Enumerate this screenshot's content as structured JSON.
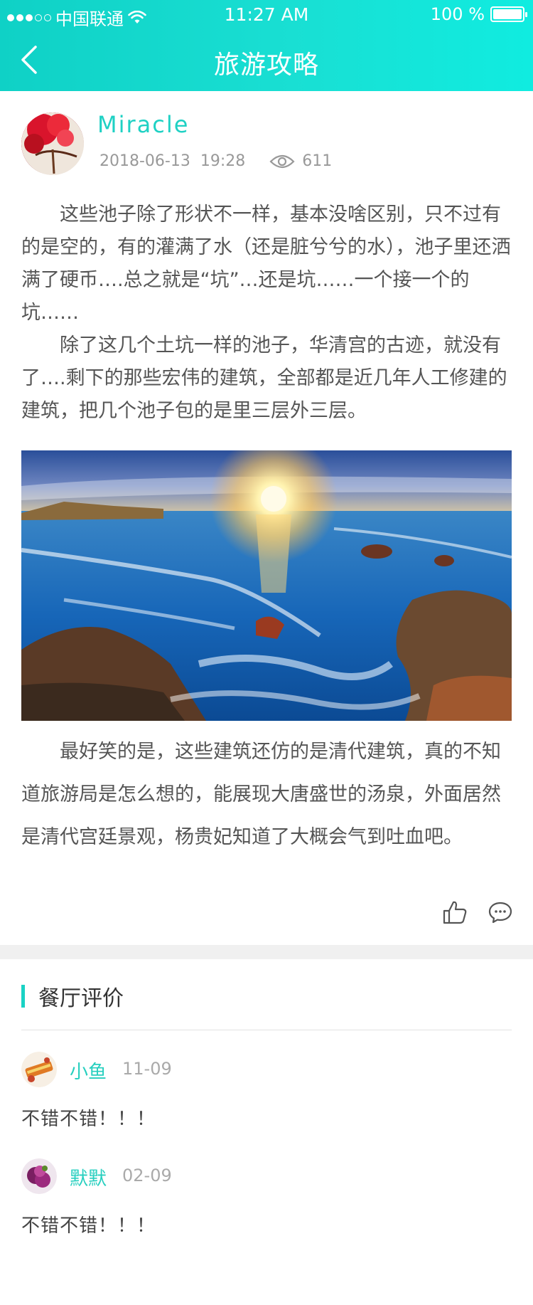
{
  "status_bar": {
    "carrier": "中国联通",
    "time": "11:27 AM",
    "battery": "100 %",
    "battery_level": 1.0
  },
  "nav": {
    "title": "旅游攻略",
    "back_icon": "chevron-left-icon"
  },
  "article": {
    "author": "Miracle",
    "date": "2018-06-13",
    "time": "19:28",
    "views": "611",
    "paragraphs": [
      "这些池子除了形状不一样，基本没啥区别，只不过有的是空的，有的灌满了水（还是脏兮兮的水），池子里还洒满了硬币….总之就是“坑”…还是坑……一个接一个的坑……",
      "除了这几个土坑一样的池子，华清宫的古迹，就没有了….剩下的那些宏伟的建筑，全部都是近几年人工修建的建筑，把几个池子包的是里三层外三层。",
      "最好笑的是，这些建筑还仿的是清代建筑，真的不知道旅游局是怎么想的，能展现大唐盛世的汤泉，外面居然是清代宫廷景观，杨贵妃知道了大概会气到吐血吧。"
    ]
  },
  "reviews": {
    "title": "餐厅评价",
    "items": [
      {
        "name": "小鱼",
        "date": "11-09",
        "text": "不错不错！！！"
      },
      {
        "name": "默默",
        "date": "02-09",
        "text": "不错不错！！！"
      }
    ]
  },
  "colors": {
    "accent": "#19d2c4",
    "header_start": "#0fd1c6",
    "header_end": "#10ece0"
  }
}
